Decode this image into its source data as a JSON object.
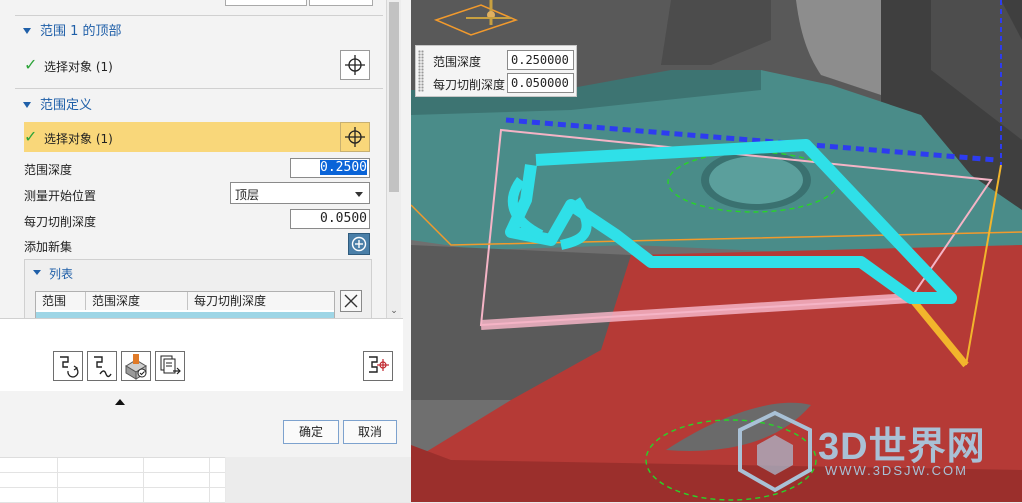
{
  "panel": {
    "section_top": {
      "title": "范围 1 的顶部",
      "select_label": "选择对象 (1)"
    },
    "section_define": {
      "title": "范围定义",
      "select_label": "选择对象 (1)"
    },
    "range_depth": {
      "label": "范围深度",
      "value": "0.2500"
    },
    "measure_start": {
      "label": "测量开始位置",
      "value": "顶层"
    },
    "cut_depth": {
      "label": "每刀切削深度",
      "value": "0.0500"
    },
    "add_set_label": "添加新集",
    "list": {
      "title": "列表",
      "columns": [
        "范围",
        "范围深度",
        "每刀切削深度"
      ]
    }
  },
  "toolbar": {
    "icons": [
      "regenerate-path-icon",
      "replay-path-icon",
      "verify-path-icon",
      "list-path-icon",
      "display-range-icon"
    ]
  },
  "dialog": {
    "ok_label": "确定",
    "cancel_label": "取消"
  },
  "floating_panel": {
    "range_depth_label": "范围深度",
    "range_depth_value": "0.250000",
    "cut_depth_label": "每刀切削深度",
    "cut_depth_value": "0.050000"
  },
  "watermark": {
    "logo_text": "3D世界网",
    "url_text": "WWW.3DSJW.COM"
  },
  "colors": {
    "accent_blue": "#1f5fa8",
    "highlight_yellow": "#f9d77a",
    "check_green": "#2ea43a",
    "toolpath_cyan": "#2fe0e8",
    "part_red": "#b53a36",
    "part_teal": "#4a8c89"
  }
}
